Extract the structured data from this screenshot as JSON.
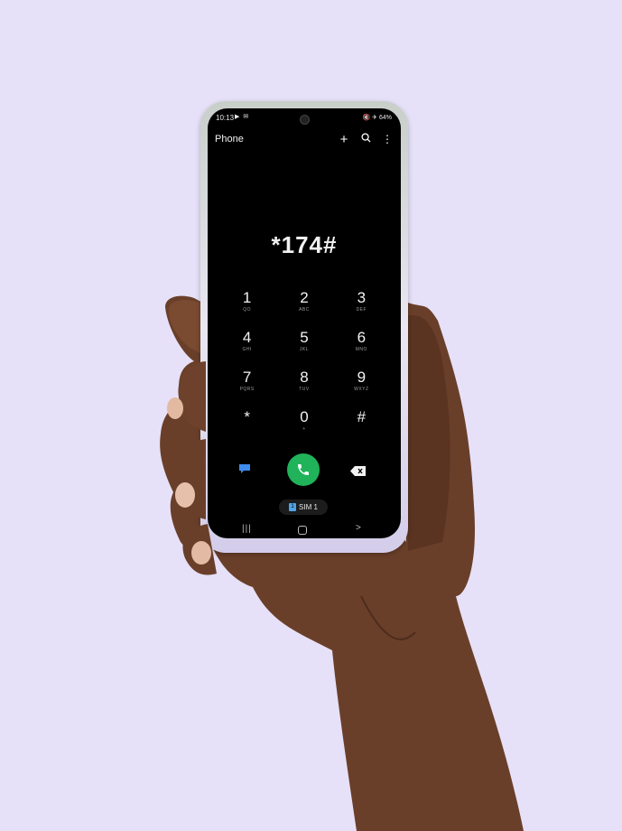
{
  "status": {
    "time": "10:13",
    "notification_icons": "▶ ✉",
    "right_icons": "🔇 ✈",
    "battery": "64%"
  },
  "appbar": {
    "title": "Phone",
    "plus_icon": "+",
    "more_icon": "⋮"
  },
  "dialer": {
    "display": "*174#",
    "keys": [
      {
        "digit": "1",
        "sub": "QO"
      },
      {
        "digit": "2",
        "sub": "ABC"
      },
      {
        "digit": "3",
        "sub": "DEF"
      },
      {
        "digit": "4",
        "sub": "GHI"
      },
      {
        "digit": "5",
        "sub": "JKL"
      },
      {
        "digit": "6",
        "sub": "MNO"
      },
      {
        "digit": "7",
        "sub": "PQRS"
      },
      {
        "digit": "8",
        "sub": "TUV"
      },
      {
        "digit": "9",
        "sub": "WXYZ"
      },
      {
        "digit": "*",
        "sub": ""
      },
      {
        "digit": "0",
        "sub": "+"
      },
      {
        "digit": "#",
        "sub": ""
      }
    ]
  },
  "sim": {
    "badge": "1",
    "label": "SIM 1"
  },
  "navbar": {
    "recent": "|||",
    "back": ">"
  },
  "colors": {
    "background": "#e6e1f8",
    "call_button": "#20b35a",
    "message_icon": "#3f8cf0",
    "sim_badge": "#4fa3e8"
  }
}
